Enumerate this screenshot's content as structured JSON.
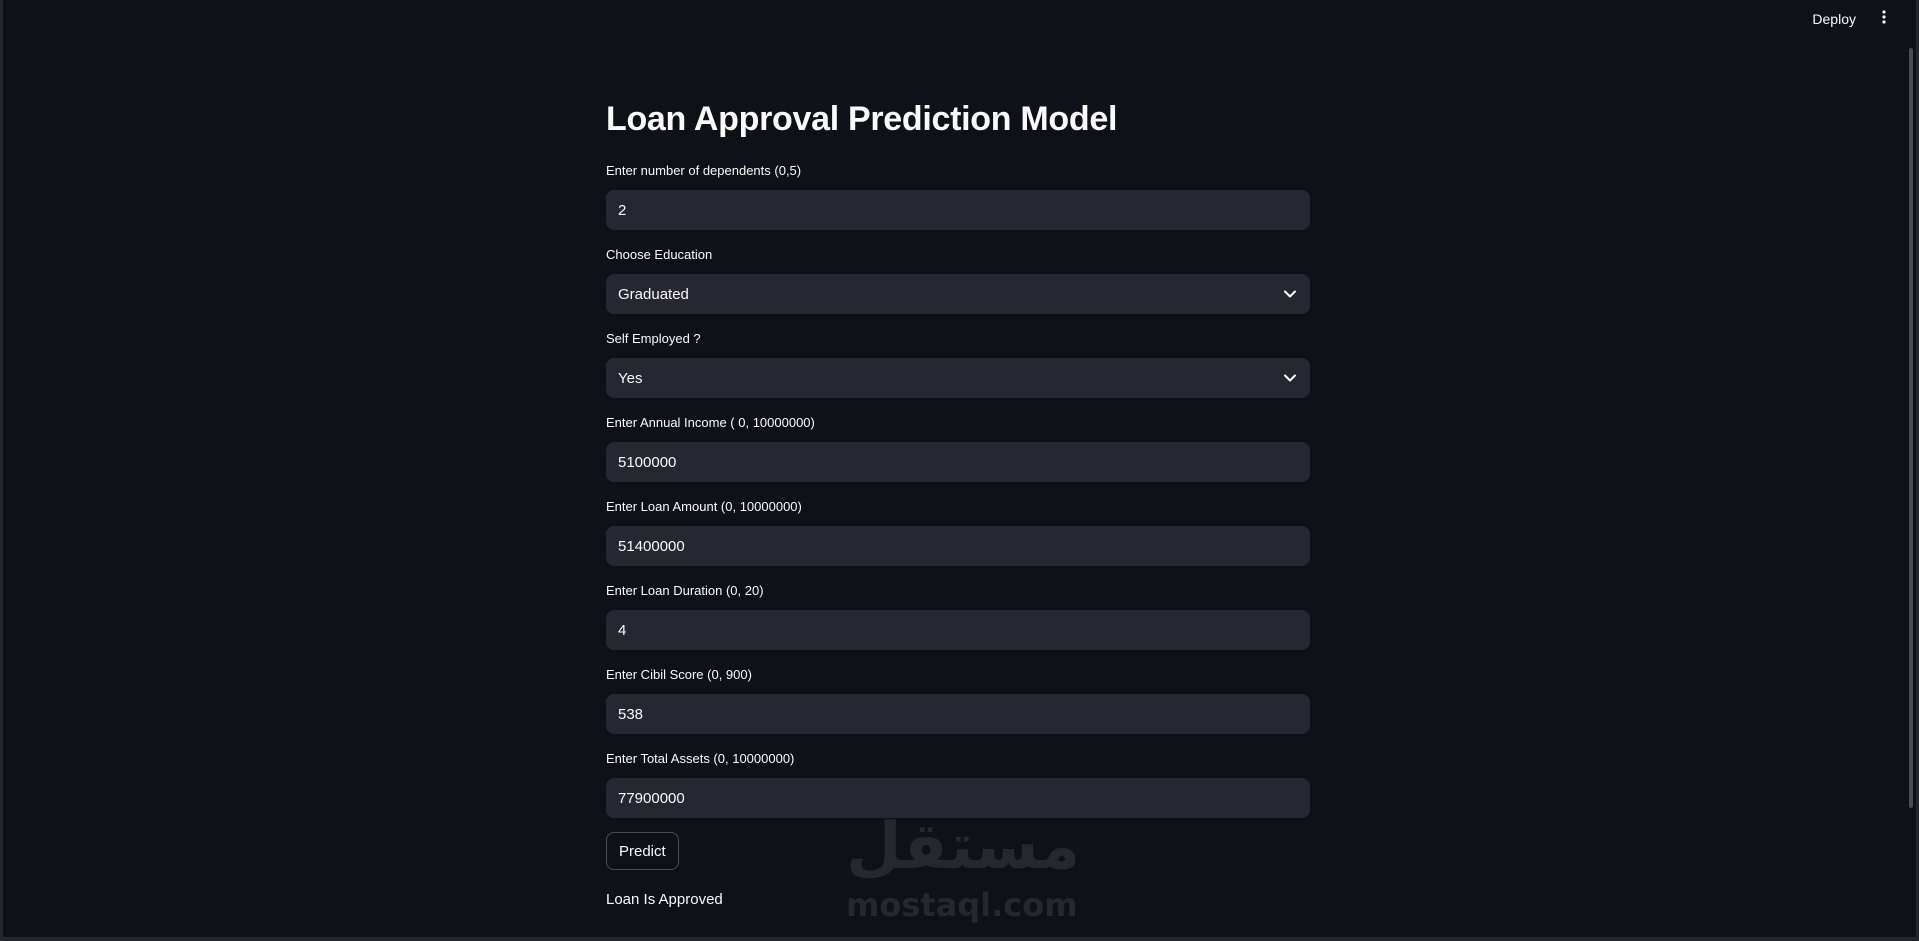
{
  "topbar": {
    "deploy_label": "Deploy"
  },
  "main": {
    "title": "Loan Approval Prediction Model",
    "fields": [
      {
        "label": "Enter number of dependents (0,5)",
        "value": "2"
      },
      {
        "label": "Choose Education",
        "value": "Graduated"
      },
      {
        "label": "Self Employed ?",
        "value": "Yes"
      },
      {
        "label": "Enter Annual Income ( 0, 10000000)",
        "value": "5100000"
      },
      {
        "label": "Enter Loan Amount (0, 10000000)",
        "value": "51400000"
      },
      {
        "label": "Enter Loan Duration (0, 20)",
        "value": "4"
      },
      {
        "label": "Enter Cibil Score (0, 900)",
        "value": "538"
      },
      {
        "label": "Enter Total Assets (0, 10000000)",
        "value": "77900000"
      }
    ],
    "predict_label": "Predict",
    "result_text": "Loan Is Approved"
  },
  "watermark": {
    "brand": "مستقل",
    "url": "mostaql.com"
  },
  "colors": {
    "background": "#0e1117",
    "input_bg": "#262730",
    "text": "#fafafa",
    "button_border": "#4a4c55"
  },
  "icons": {
    "menu": "vertical-dots-icon",
    "dropdown": "chevron-down-icon"
  }
}
